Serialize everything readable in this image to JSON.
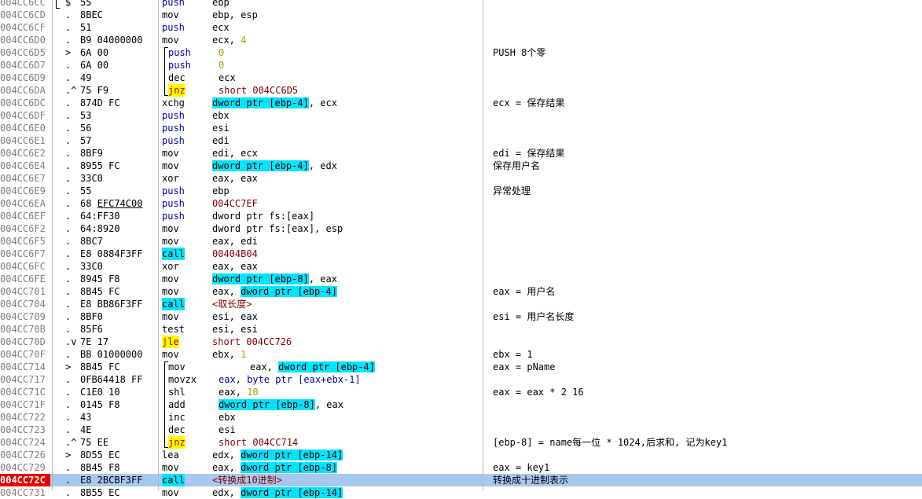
{
  "selected_row": 38,
  "rows": [
    {
      "addr": "004CC6CC",
      "mark": "$",
      "hex": "55",
      "mnem": "push",
      "mnem_style": "blue",
      "ops": [
        {
          "t": "ebp"
        }
      ],
      "comment": ""
    },
    {
      "addr": "004CC6CD",
      "mark": ".",
      "hex": "8BEC",
      "mnem": "mov",
      "ops": [
        {
          "t": "ebp, esp"
        }
      ],
      "comment": ""
    },
    {
      "addr": "004CC6CF",
      "mark": ".",
      "hex": "51",
      "mnem": "push",
      "mnem_style": "blue",
      "ops": [
        {
          "t": "ecx"
        }
      ],
      "comment": ""
    },
    {
      "addr": "004CC6D0",
      "mark": ".",
      "hex": "B9 04000000",
      "mnem": "mov",
      "ops": [
        {
          "t": "ecx, "
        },
        {
          "t": "4",
          "c": "num"
        }
      ],
      "comment": ""
    },
    {
      "addr": "004CC6D5",
      "mark": ">",
      "hex": "6A 00",
      "mnem": "push",
      "mnem_style": "blue",
      "indent": 1,
      "ops": [
        {
          "t": "0",
          "c": "num"
        }
      ],
      "comment": "PUSH 8个零"
    },
    {
      "addr": "004CC6D7",
      "mark": ".",
      "hex": "6A 00",
      "mnem": "push",
      "mnem_style": "blue",
      "indent": 1,
      "ops": [
        {
          "t": "0",
          "c": "num"
        }
      ],
      "comment": ""
    },
    {
      "addr": "004CC6D9",
      "mark": ".",
      "hex": "49",
      "mnem": "dec",
      "indent": 1,
      "ops": [
        {
          "t": "ecx"
        }
      ],
      "comment": ""
    },
    {
      "addr": "004CC6DA",
      "mark": ".^",
      "hex": "75 F9",
      "mnem": "jnz",
      "mnem_style": "jmp",
      "indent": 1,
      "ops": [
        {
          "t": "short 004CC6D5",
          "c": "imm"
        }
      ],
      "comment": ""
    },
    {
      "addr": "004CC6DC",
      "mark": ".",
      "hex": "874D FC",
      "mnem": "xchg",
      "ops": [
        {
          "t": "dword ptr [ebp-4]",
          "c": "mem"
        },
        {
          "t": ", ecx"
        }
      ],
      "comment": "ecx = 保存结果"
    },
    {
      "addr": "004CC6DF",
      "mark": ".",
      "hex": "53",
      "mnem": "push",
      "mnem_style": "blue",
      "ops": [
        {
          "t": "ebx"
        }
      ],
      "comment": ""
    },
    {
      "addr": "004CC6E0",
      "mark": ".",
      "hex": "56",
      "mnem": "push",
      "mnem_style": "blue",
      "ops": [
        {
          "t": "esi"
        }
      ],
      "comment": ""
    },
    {
      "addr": "004CC6E1",
      "mark": ".",
      "hex": "57",
      "mnem": "push",
      "mnem_style": "blue",
      "ops": [
        {
          "t": "edi"
        }
      ],
      "comment": ""
    },
    {
      "addr": "004CC6E2",
      "mark": ".",
      "hex": "8BF9",
      "mnem": "mov",
      "ops": [
        {
          "t": "edi, ecx"
        }
      ],
      "comment": "edi = 保存结果"
    },
    {
      "addr": "004CC6E4",
      "mark": ".",
      "hex": "8955 FC",
      "mnem": "mov",
      "ops": [
        {
          "t": "dword ptr [ebp-4]",
          "c": "mem"
        },
        {
          "t": ", edx"
        }
      ],
      "comment": "保存用户名"
    },
    {
      "addr": "004CC6E7",
      "mark": ".",
      "hex": "33C0",
      "mnem": "xor",
      "ops": [
        {
          "t": "eax, eax"
        }
      ],
      "comment": ""
    },
    {
      "addr": "004CC6E9",
      "mark": ".",
      "hex": "55",
      "mnem": "push",
      "mnem_style": "blue",
      "ops": [
        {
          "t": "ebp"
        }
      ],
      "comment": "异常处理"
    },
    {
      "addr": "004CC6EA",
      "mark": ".",
      "hex": "68 EFC74C00",
      "hex_underline": true,
      "mnem": "push",
      "mnem_style": "blue",
      "ops": [
        {
          "t": "004CC7EF",
          "c": "imm"
        }
      ],
      "comment": ""
    },
    {
      "addr": "004CC6EF",
      "mark": ".",
      "hex": "64:FF30",
      "mnem": "push",
      "mnem_style": "blue",
      "ops": [
        {
          "t": "dword ptr fs:[eax]"
        }
      ],
      "comment": ""
    },
    {
      "addr": "004CC6F2",
      "mark": ".",
      "hex": "64:8920",
      "mnem": "mov",
      "ops": [
        {
          "t": "dword ptr fs:[eax], esp"
        }
      ],
      "comment": ""
    },
    {
      "addr": "004CC6F5",
      "mark": ".",
      "hex": "8BC7",
      "mnem": "mov",
      "ops": [
        {
          "t": "eax, edi"
        }
      ],
      "comment": ""
    },
    {
      "addr": "004CC6F7",
      "mark": ".",
      "hex": "E8 0884F3FF",
      "mnem": "call",
      "mnem_style": "call",
      "ops": [
        {
          "t": "00404B04",
          "c": "imm"
        }
      ],
      "comment": ""
    },
    {
      "addr": "004CC6FC",
      "mark": ".",
      "hex": "33C0",
      "mnem": "xor",
      "ops": [
        {
          "t": "eax, eax"
        }
      ],
      "comment": ""
    },
    {
      "addr": "004CC6FE",
      "mark": ".",
      "hex": "8945 F8",
      "mnem": "mov",
      "ops": [
        {
          "t": "dword ptr [ebp-8]",
          "c": "mem"
        },
        {
          "t": ", eax"
        }
      ],
      "comment": ""
    },
    {
      "addr": "004CC701",
      "mark": ".",
      "hex": "8B45 FC",
      "mnem": "mov",
      "ops": [
        {
          "t": "eax, "
        },
        {
          "t": "dword ptr [ebp-4]",
          "c": "mem"
        }
      ],
      "comment": "eax = 用户名"
    },
    {
      "addr": "004CC704",
      "mark": ".",
      "hex": "E8 BB86F3FF",
      "mnem": "call",
      "mnem_style": "call",
      "ops": [
        {
          "t": "<取长度>",
          "c": "imm"
        }
      ],
      "comment": ""
    },
    {
      "addr": "004CC709",
      "mark": ".",
      "hex": "8BF0",
      "mnem": "mov",
      "ops": [
        {
          "t": "esi, eax"
        }
      ],
      "comment": "esi = 用户名长度"
    },
    {
      "addr": "004CC70B",
      "mark": ".",
      "hex": "85F6",
      "mnem": "test",
      "ops": [
        {
          "t": "esi, esi"
        }
      ],
      "comment": ""
    },
    {
      "addr": "004CC70D",
      "mark": ".v",
      "hex": "7E 17",
      "mnem": "jle",
      "mnem_style": "jmp",
      "ops": [
        {
          "t": "short 004CC726",
          "c": "imm"
        }
      ],
      "comment": ""
    },
    {
      "addr": "004CC70F",
      "mark": ".",
      "hex": "BB 01000000",
      "mnem": "mov",
      "ops": [
        {
          "t": "ebx, "
        },
        {
          "t": "1",
          "c": "num"
        }
      ],
      "comment": "ebx = 1"
    },
    {
      "addr": "004CC714",
      "mark": ">",
      "hex": "8B45 FC",
      "mnem": "mov",
      "indent": 1,
      "ops_indent": 2,
      "ops": [
        {
          "t": "eax, "
        },
        {
          "t": "dword ptr [ebp-4]",
          "c": "mem"
        }
      ],
      "comment": "eax = pName"
    },
    {
      "addr": "004CC717",
      "mark": ".",
      "hex": "0FB64418 FF",
      "mnem": "movzx",
      "indent": 1,
      "ops": [
        {
          "t": "eax, byte ptr [eax+ebx-1]",
          "c": "bluetext"
        }
      ],
      "comment": ""
    },
    {
      "addr": "004CC71C",
      "mark": ".",
      "hex": "C1E0 10",
      "mnem": "shl",
      "indent": 1,
      "ops": [
        {
          "t": "eax, "
        },
        {
          "t": "10",
          "c": "num"
        }
      ],
      "comment": "eax = eax * 2 16"
    },
    {
      "addr": "004CC71F",
      "mark": ".",
      "hex": "0145 F8",
      "mnem": "add",
      "indent": 1,
      "ops": [
        {
          "t": "dword ptr [ebp-8]",
          "c": "mem"
        },
        {
          "t": ", eax"
        }
      ],
      "comment": ""
    },
    {
      "addr": "004CC722",
      "mark": ".",
      "hex": "43",
      "mnem": "inc",
      "indent": 1,
      "ops": [
        {
          "t": "ebx"
        }
      ],
      "comment": ""
    },
    {
      "addr": "004CC723",
      "mark": ".",
      "hex": "4E",
      "mnem": "dec",
      "indent": 1,
      "ops": [
        {
          "t": "esi"
        }
      ],
      "comment": ""
    },
    {
      "addr": "004CC724",
      "mark": ".^",
      "hex": "75 EE",
      "mnem": "jnz",
      "mnem_style": "jmp",
      "indent": 1,
      "ops": [
        {
          "t": "short 004CC714",
          "c": "imm"
        }
      ],
      "comment": "[ebp-8] = name每一位 * 1024,后求和, 记为key1"
    },
    {
      "addr": "004CC726",
      "mark": ">",
      "hex": "8D55 EC",
      "mnem": "lea",
      "ops": [
        {
          "t": "edx, "
        },
        {
          "t": "dword ptr [ebp-14]",
          "c": "mem"
        }
      ],
      "comment": ""
    },
    {
      "addr": "004CC729",
      "mark": ".",
      "hex": "8B45 F8",
      "mnem": "mov",
      "ops": [
        {
          "t": "eax, "
        },
        {
          "t": "dword ptr [ebp-8]",
          "c": "mem"
        }
      ],
      "comment": "eax = key1"
    },
    {
      "addr": "004CC72C",
      "mark": ".",
      "hex": "E8 2BCBF3FF",
      "mnem": "call",
      "mnem_style": "call",
      "ops": [
        {
          "t": "<转换成10进制>",
          "c": "imm"
        }
      ],
      "comment": "转换成十进制表示"
    },
    {
      "addr": "004CC731",
      "mark": ".",
      "hex": "8B55 EC",
      "mnem": "mov",
      "ops": [
        {
          "t": "edx, "
        },
        {
          "t": "dword ptr [ebp-14]",
          "c": "mem"
        }
      ],
      "comment": ""
    }
  ]
}
